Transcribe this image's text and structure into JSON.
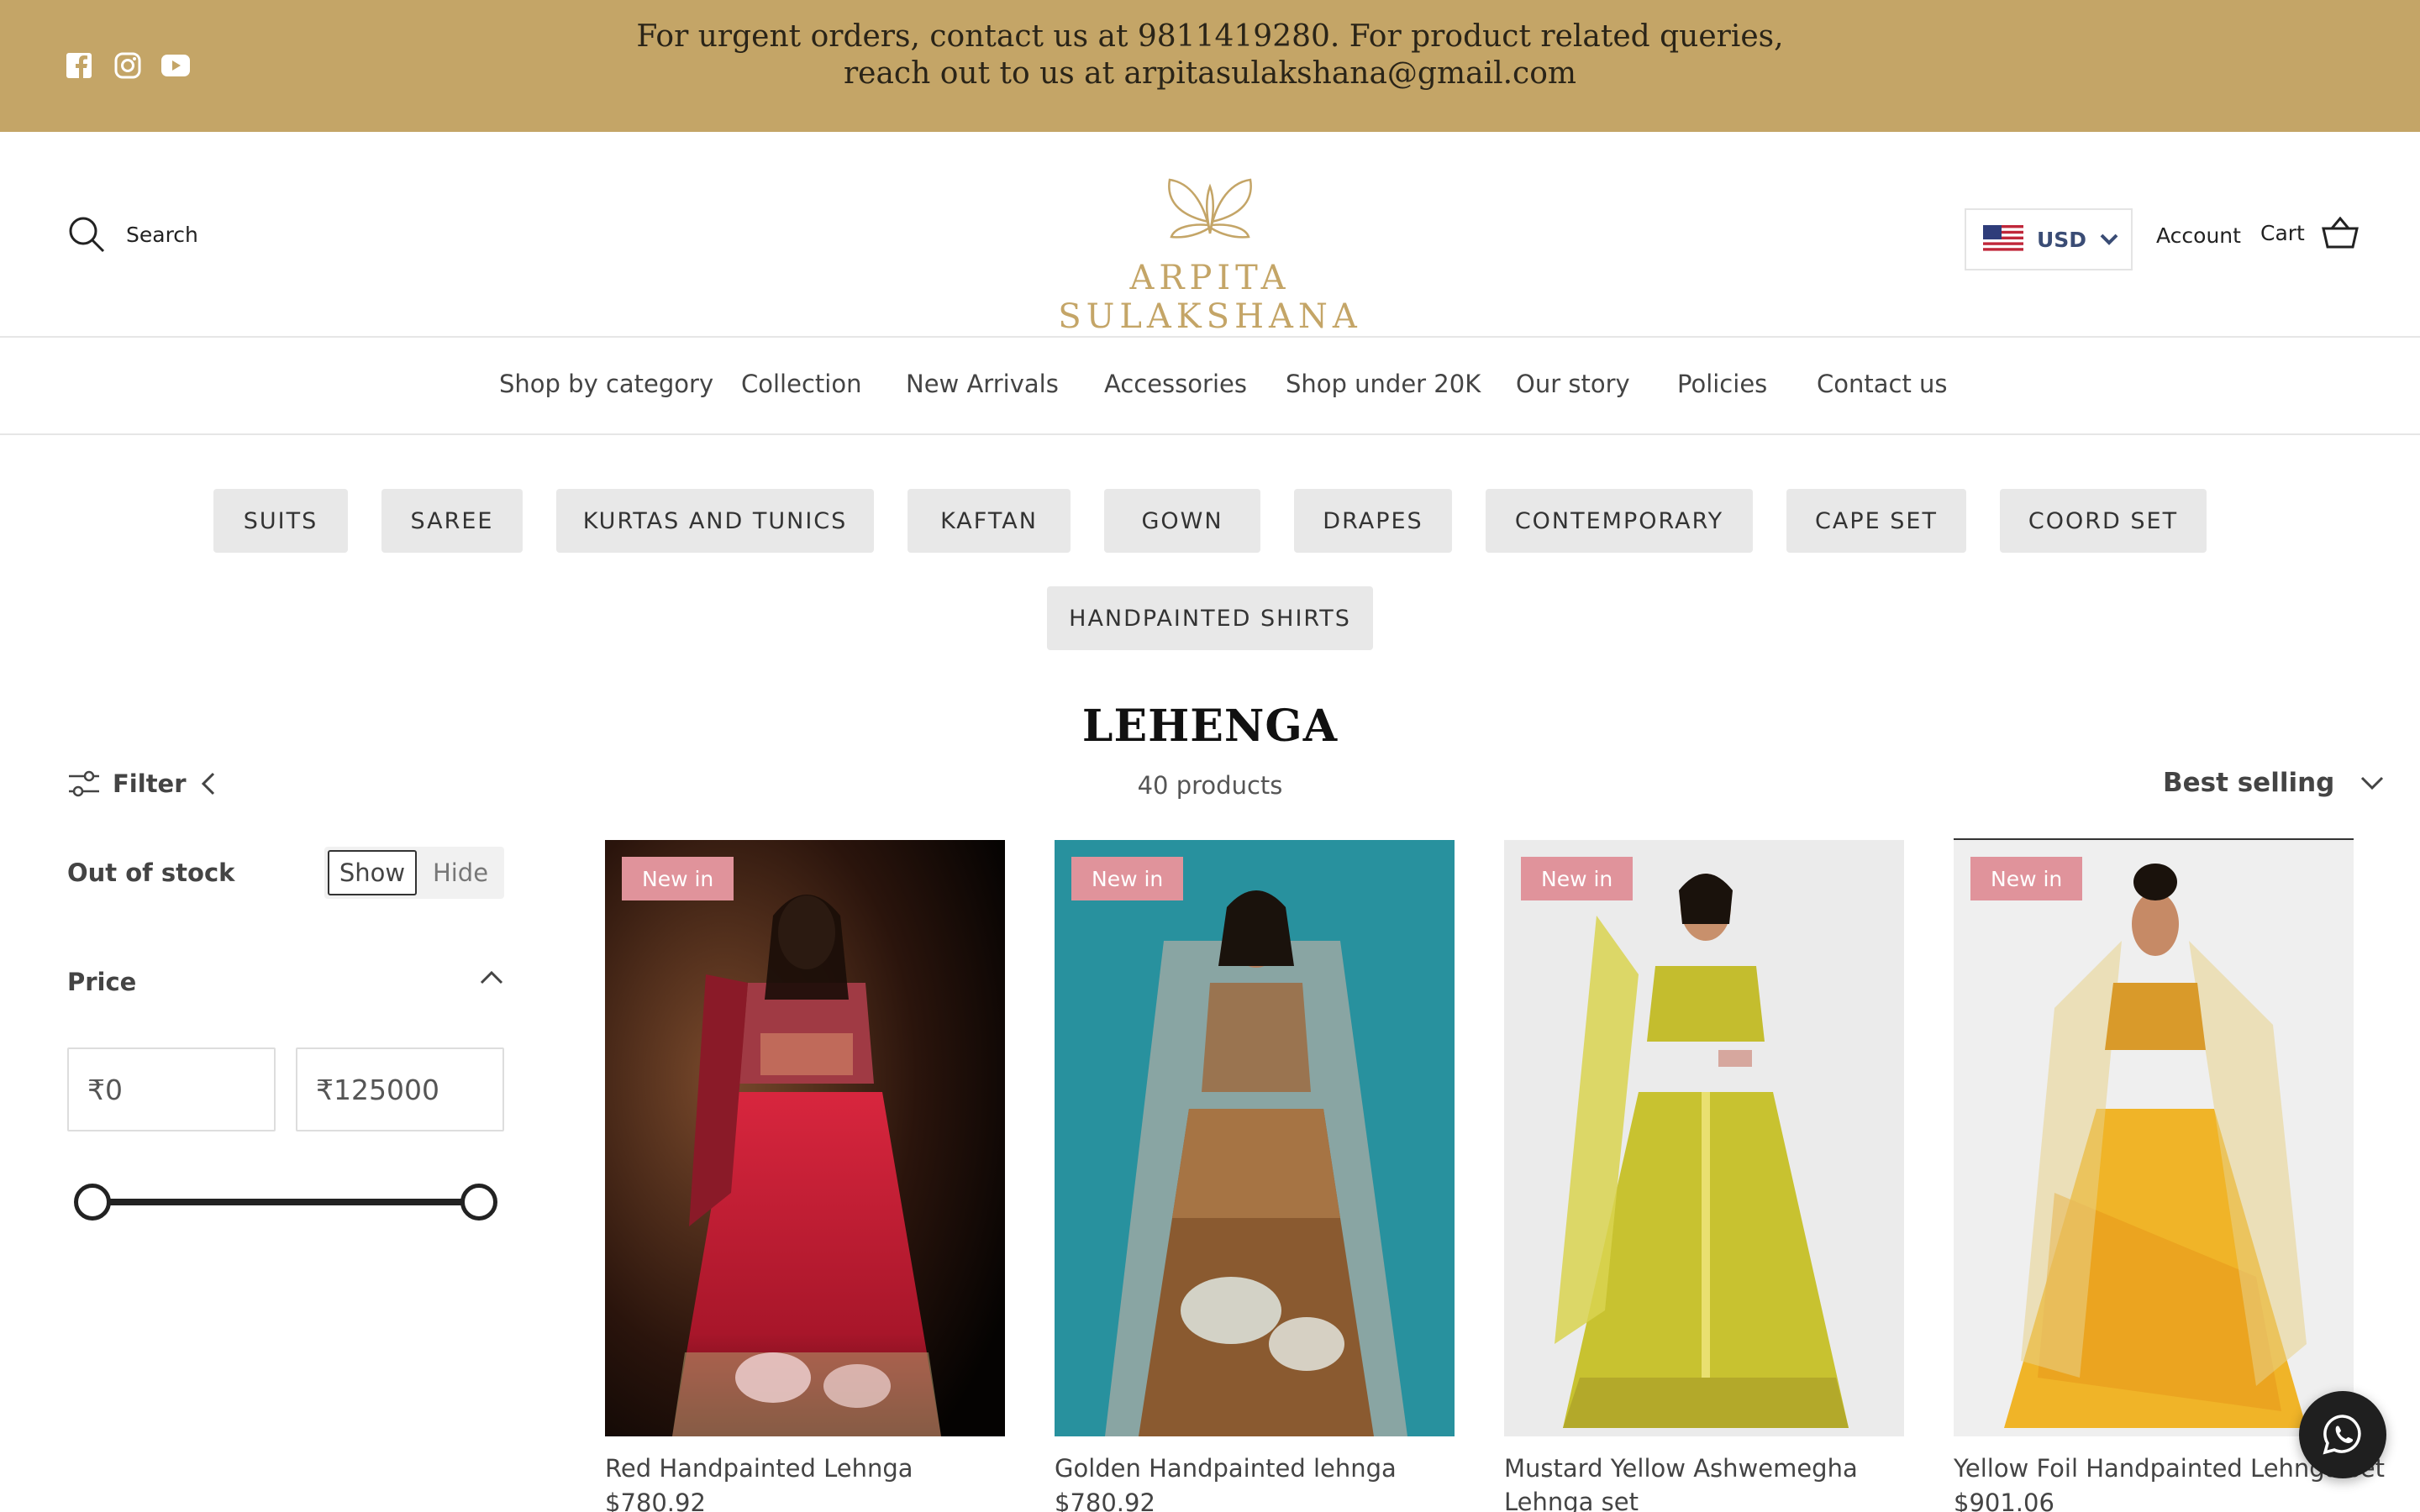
{
  "announcement": {
    "text": "For urgent orders, contact us at 9811419280. For product related queries, reach out to us at arpitasulakshana@gmail.com",
    "social_icons": [
      "facebook-icon",
      "instagram-icon",
      "youtube-icon"
    ]
  },
  "header": {
    "search_label": "Search",
    "logo_text": "ARPITA SULAKSHANA",
    "currency": "USD",
    "account_label": "Account",
    "cart_label": "Cart"
  },
  "nav": {
    "items": [
      "Shop by category",
      "Collection",
      "New Arrivals",
      "Accessories",
      "Shop under 20K",
      "Our story",
      "Policies",
      "Contact us"
    ]
  },
  "categories": [
    "SUITS",
    "SAREE",
    "KURTAS AND TUNICS",
    "KAFTAN",
    "GOWN",
    "DRAPES",
    "CONTEMPORARY",
    "CAPE SET",
    "COORD SET",
    "HANDPAINTED SHIRTS"
  ],
  "collection": {
    "title": "LEHENGA",
    "count": "40 products"
  },
  "filters": {
    "toggle_label": "Filter",
    "out_of_stock_label": "Out of stock",
    "show_label": "Show",
    "hide_label": "Hide",
    "price_label": "Price",
    "price_min": "₹0",
    "price_max": "₹125000"
  },
  "sort": {
    "label": "Best selling"
  },
  "products": [
    {
      "badge": "New in",
      "name": "Red Handpainted Lehnga",
      "price": "$780.92"
    },
    {
      "badge": "New in",
      "name": "Golden Handpainted lehnga",
      "price": "$780.92"
    },
    {
      "badge": "New in",
      "name": "Mustard Yellow Ashwemegha Lehnga set",
      "price": ""
    },
    {
      "badge": "New in",
      "name": "Yellow Foil Handpainted Lehnga set",
      "price": "$901.06"
    }
  ],
  "colors": {
    "announcement_bg": "#c4a567",
    "badge_bg": "#e0939b",
    "pill_bg": "#e8e8e8"
  }
}
